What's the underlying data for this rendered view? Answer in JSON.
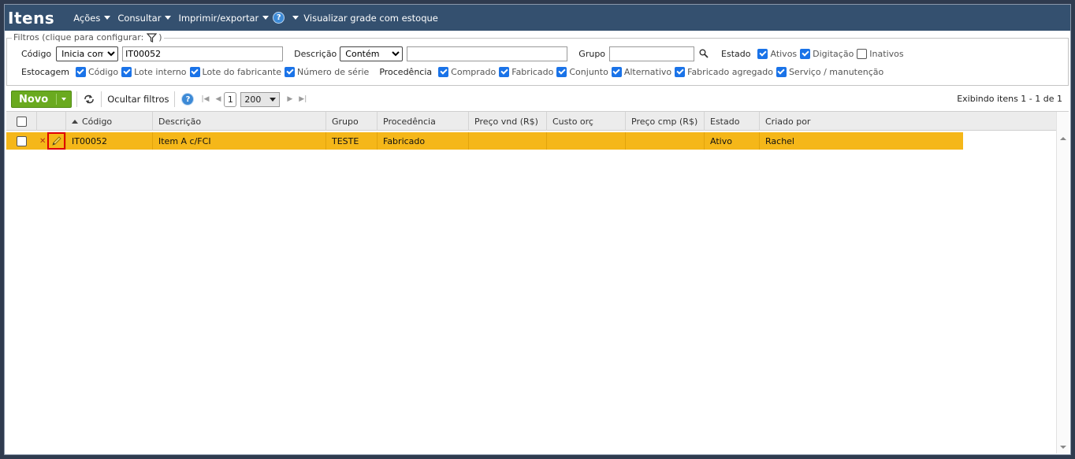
{
  "header": {
    "title": "Itens",
    "menu": [
      {
        "label": "Ações",
        "dropdown": true
      },
      {
        "label": "Consultar",
        "dropdown": true
      },
      {
        "label": "Imprimir/exportar",
        "dropdown": true
      }
    ],
    "help_icon": "help-icon",
    "visualizar_label": "Visualizar grade com estoque"
  },
  "filters": {
    "legend": "Filtros (clique para configurar:",
    "legend_close": ")",
    "codigo_label": "Código",
    "codigo_mode": "Inicia com",
    "codigo_value": "IT00052",
    "descricao_label": "Descrição",
    "descricao_mode": "Contém",
    "descricao_value": "",
    "grupo_label": "Grupo",
    "grupo_value": "",
    "estado_label": "Estado",
    "estado_options": [
      {
        "label": "Ativos",
        "checked": true
      },
      {
        "label": "Digitação",
        "checked": true
      },
      {
        "label": "Inativos",
        "checked": false
      }
    ],
    "estocagem_label": "Estocagem",
    "estocagem_options": [
      {
        "label": "Código",
        "checked": true
      },
      {
        "label": "Lote interno",
        "checked": true
      },
      {
        "label": "Lote do fabricante",
        "checked": true
      },
      {
        "label": "Número de série",
        "checked": true
      }
    ],
    "procedencia_label": "Procedência",
    "procedencia_options": [
      {
        "label": "Comprado",
        "checked": true
      },
      {
        "label": "Fabricado",
        "checked": true
      },
      {
        "label": "Conjunto",
        "checked": true
      },
      {
        "label": "Alternativo",
        "checked": true
      },
      {
        "label": "Fabricado agregado",
        "checked": true
      },
      {
        "label": "Serviço / manutenção",
        "checked": true
      }
    ]
  },
  "toolbar": {
    "novo_label": "Novo",
    "ocultar_label": "Ocultar filtros",
    "page": "1",
    "page_size": "200",
    "status": "Exibindo itens 1 - 1 de 1"
  },
  "grid": {
    "columns": [
      "Código",
      "Descrição",
      "Grupo",
      "Procedência",
      "Preço vnd (R$)",
      "Custo orç",
      "Preço cmp (R$)",
      "Estado",
      "Criado por"
    ],
    "rows": [
      {
        "codigo": "IT00052",
        "descricao": "Item A c/FCI",
        "grupo": "TESTE",
        "procedencia": "Fabricado",
        "preco_vnd": "",
        "custo_orc": "",
        "preco_cmp": "",
        "estado": "Ativo",
        "criado_por": "Rachel",
        "selected": true
      }
    ]
  },
  "colors": {
    "titlebar": "#34506f",
    "selected_row": "#f5b719",
    "novo_button": "#6aaa1f",
    "checkbox": "#1a73e8",
    "highlight": "#e00000"
  }
}
